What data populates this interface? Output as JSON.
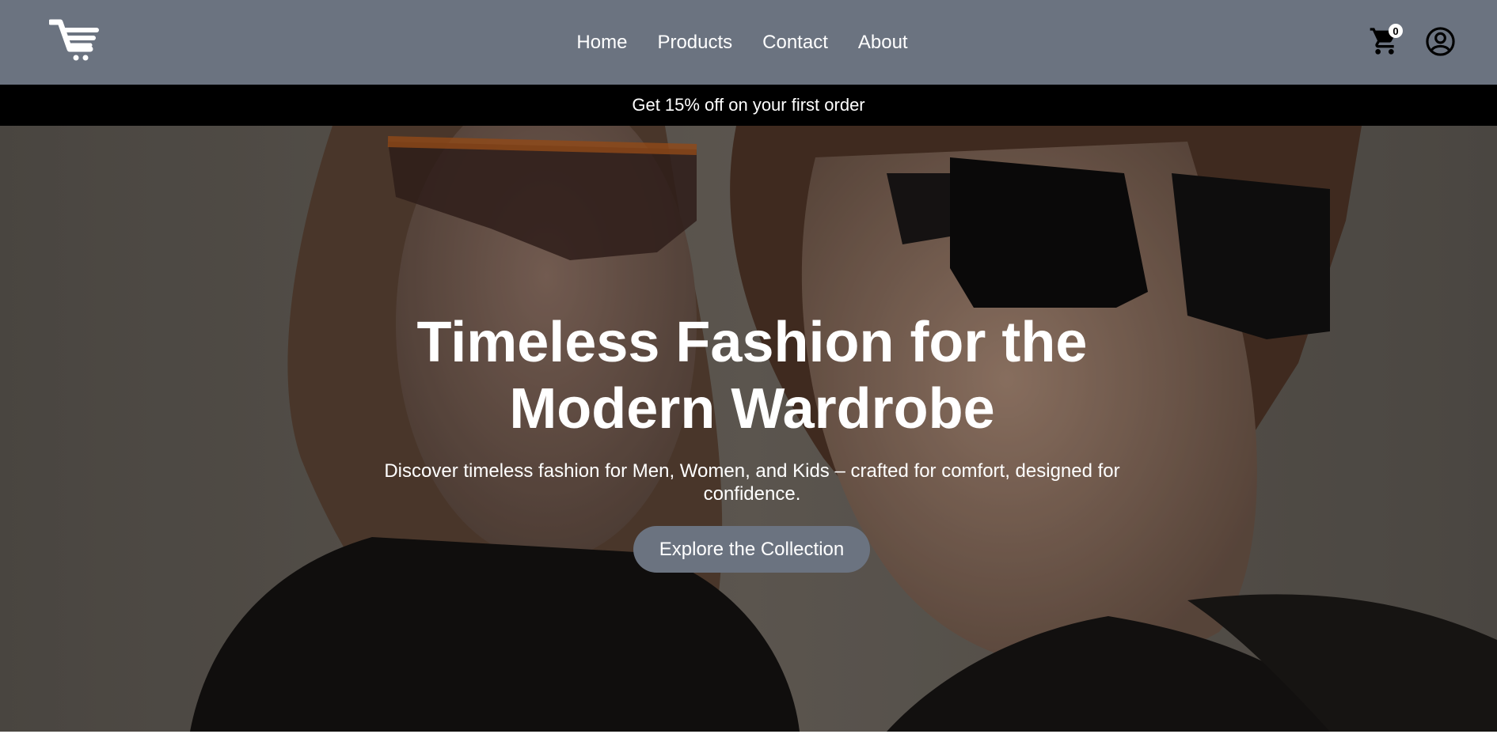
{
  "header": {
    "logo_icon": "cart-logo-icon",
    "nav": [
      {
        "label": "Home"
      },
      {
        "label": "Products"
      },
      {
        "label": "Contact"
      },
      {
        "label": "About"
      }
    ],
    "cart_count": "0",
    "cart_icon": "shopping-cart-icon",
    "user_icon": "user-account-icon"
  },
  "promo": {
    "text": "Get 15% off on your first order"
  },
  "hero": {
    "title_line1": "Timeless Fashion for the",
    "title_line2": "Modern Wardrobe",
    "subtitle": "Discover timeless fashion for Men, Women, and Kids – crafted for comfort, designed for confidence.",
    "cta_label": "Explore the Collection"
  },
  "colors": {
    "navbar": "#6b7380",
    "promo_bar": "#000000",
    "cta": "#6b7380",
    "text": "#ffffff"
  }
}
